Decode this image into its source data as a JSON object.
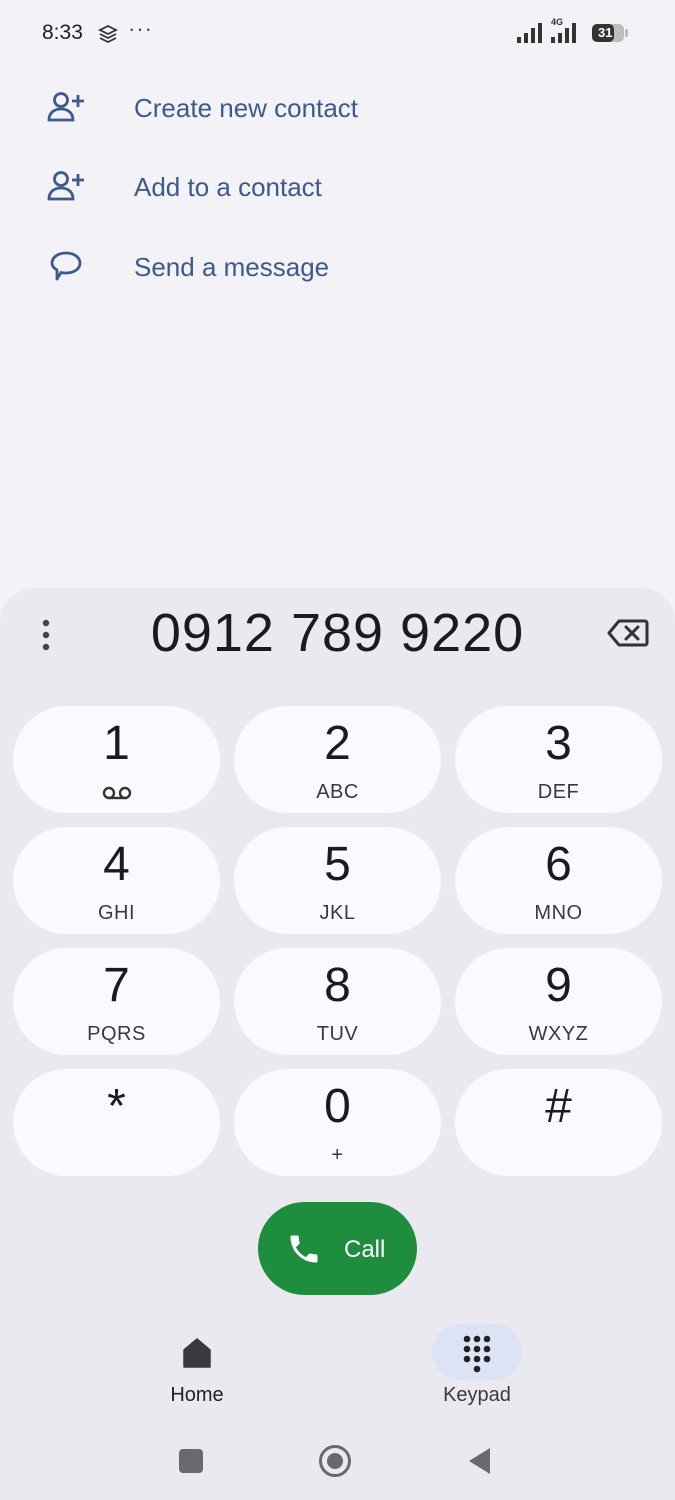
{
  "status_bar": {
    "time": "8:33",
    "overflow": "···",
    "network": "4G",
    "battery": "31",
    "app_icon": "layers-icon",
    "signal_icon": "signal-bars-icon"
  },
  "options": [
    {
      "label": "Create new contact",
      "icon": "add-person-icon"
    },
    {
      "label": "Add to a contact",
      "icon": "add-person-icon"
    },
    {
      "label": "Send a message",
      "icon": "message-bubble-icon"
    }
  ],
  "dialer": {
    "number": "0912 789 9220",
    "keys": [
      {
        "digit": "1",
        "letters": "",
        "icon": "voicemail-icon"
      },
      {
        "digit": "2",
        "letters": "ABC"
      },
      {
        "digit": "3",
        "letters": "DEF"
      },
      {
        "digit": "4",
        "letters": "GHI"
      },
      {
        "digit": "5",
        "letters": "JKL"
      },
      {
        "digit": "6",
        "letters": "MNO"
      },
      {
        "digit": "7",
        "letters": "PQRS"
      },
      {
        "digit": "8",
        "letters": "TUV"
      },
      {
        "digit": "9",
        "letters": "WXYZ"
      },
      {
        "digit": "*",
        "letters": ""
      },
      {
        "digit": "0",
        "letters": "+"
      },
      {
        "digit": "#",
        "letters": ""
      }
    ],
    "call_label": "Call"
  },
  "bottom_nav": {
    "items": [
      {
        "label": "Home",
        "icon": "home-icon",
        "selected": false
      },
      {
        "label": "Keypad",
        "icon": "dialpad-icon",
        "selected": true
      }
    ]
  },
  "colors": {
    "accent": "#3e5a8a",
    "call_green": "#1e8e3e",
    "key_background": "#fafafe",
    "sheet_background": "#e9e9ef",
    "selected_pill": "#dce3f4"
  }
}
